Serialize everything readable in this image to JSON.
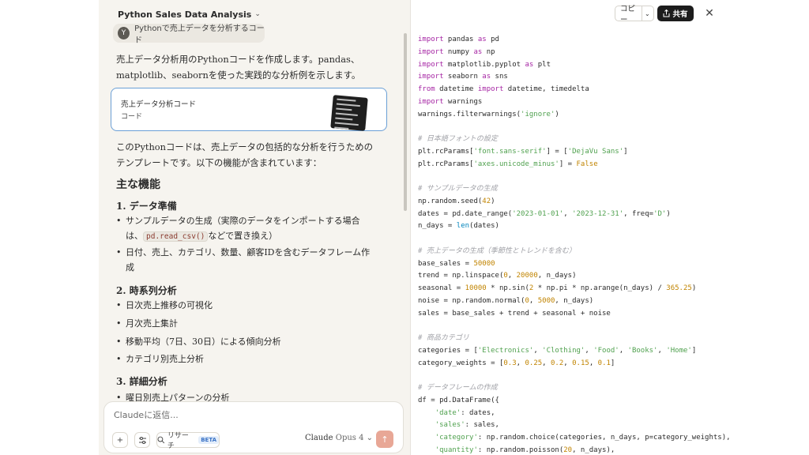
{
  "chat": {
    "title": "Python Sales Data Analysis",
    "caret": "⌄",
    "user_avatar": "Y",
    "user_message": "Pythonで売上データを分析するコード",
    "intro": "売上データ分析用のPythonコードを作成します。pandas、matplotlib、seabornを使った実践的な分析例を示します。",
    "artifact": {
      "title": "売上データ分析コード",
      "subtitle": "コード"
    },
    "summary": "このPythonコードは、売上データの包括的な分析を行うためのテンプレートです。以下の機能が含まれています：",
    "main_heading": "主な機能",
    "sections": [
      {
        "heading": "1. データ準備",
        "items": [
          {
            "pre": "サンプルデータの生成（実際のデータをインポートする場合は、",
            "code": "pd.read_csv()",
            "post": "などで置き換え）"
          },
          {
            "pre": "日付、売上、カテゴリ、数量、顧客IDを含むデータフレーム作成"
          }
        ]
      },
      {
        "heading": "2. 時系列分析",
        "items": [
          {
            "pre": "日次売上推移の可視化"
          },
          {
            "pre": "月次売上集計"
          },
          {
            "pre": "移動平均（7日、30日）による傾向分析"
          },
          {
            "pre": "カテゴリ別売上分析"
          }
        ]
      },
      {
        "heading": "3. 詳細分析",
        "items": [
          {
            "pre": "曜日別売上パターンの分析"
          }
        ]
      }
    ],
    "composer": {
      "placeholder": "Claudeに返信...",
      "research_label": "リサーチ",
      "beta_label": "BETA",
      "model_name": "Claude",
      "model_version": "Opus 4"
    }
  },
  "artifact_panel": {
    "copy_label": "コピー",
    "share_label": "共有",
    "code_lines": [
      [
        {
          "t": "import",
          "c": "kw"
        },
        {
          "t": " pandas "
        },
        {
          "t": "as",
          "c": "kw"
        },
        {
          "t": " pd"
        }
      ],
      [
        {
          "t": "import",
          "c": "kw"
        },
        {
          "t": " numpy "
        },
        {
          "t": "as",
          "c": "kw"
        },
        {
          "t": " np"
        }
      ],
      [
        {
          "t": "import",
          "c": "kw"
        },
        {
          "t": " matplotlib.pyplot "
        },
        {
          "t": "as",
          "c": "kw"
        },
        {
          "t": " plt"
        }
      ],
      [
        {
          "t": "import",
          "c": "kw"
        },
        {
          "t": " seaborn "
        },
        {
          "t": "as",
          "c": "kw"
        },
        {
          "t": " sns"
        }
      ],
      [
        {
          "t": "from",
          "c": "kw"
        },
        {
          "t": " datetime "
        },
        {
          "t": "import",
          "c": "kw"
        },
        {
          "t": " datetime, timedelta"
        }
      ],
      [
        {
          "t": "import",
          "c": "kw"
        },
        {
          "t": " warnings"
        }
      ],
      [
        {
          "t": "warnings.filterwarnings("
        },
        {
          "t": "'ignore'",
          "c": "st"
        },
        {
          "t": ")"
        }
      ],
      [],
      [
        {
          "t": "# 日本語フォントの設定",
          "c": "cm"
        }
      ],
      [
        {
          "t": "plt.rcParams["
        },
        {
          "t": "'font.sans-serif'",
          "c": "st"
        },
        {
          "t": "] = ["
        },
        {
          "t": "'DejaVu Sans'",
          "c": "st"
        },
        {
          "t": "]"
        }
      ],
      [
        {
          "t": "plt.rcParams["
        },
        {
          "t": "'axes.unicode_minus'",
          "c": "st"
        },
        {
          "t": "] = "
        },
        {
          "t": "False",
          "c": "nm"
        }
      ],
      [],
      [
        {
          "t": "# サンプルデータの生成",
          "c": "cm"
        }
      ],
      [
        {
          "t": "np.random.seed("
        },
        {
          "t": "42",
          "c": "nm"
        },
        {
          "t": ")"
        }
      ],
      [
        {
          "t": "dates = pd.date_range("
        },
        {
          "t": "'2023-01-01'",
          "c": "st"
        },
        {
          "t": ", "
        },
        {
          "t": "'2023-12-31'",
          "c": "st"
        },
        {
          "t": ", freq="
        },
        {
          "t": "'D'",
          "c": "st"
        },
        {
          "t": ")"
        }
      ],
      [
        {
          "t": "n_days = "
        },
        {
          "t": "len",
          "c": "bl"
        },
        {
          "t": "(dates)"
        }
      ],
      [],
      [
        {
          "t": "# 売上データの生成（季節性とトレンドを含む）",
          "c": "cm"
        }
      ],
      [
        {
          "t": "base_sales = "
        },
        {
          "t": "50000",
          "c": "nm"
        }
      ],
      [
        {
          "t": "trend = np.linspace("
        },
        {
          "t": "0",
          "c": "nm"
        },
        {
          "t": ", "
        },
        {
          "t": "20000",
          "c": "nm"
        },
        {
          "t": ", n_days)"
        }
      ],
      [
        {
          "t": "seasonal = "
        },
        {
          "t": "10000",
          "c": "nm"
        },
        {
          "t": " * np.sin("
        },
        {
          "t": "2",
          "c": "nm"
        },
        {
          "t": " * np.pi * np.arange(n_days) / "
        },
        {
          "t": "365.25",
          "c": "nm"
        },
        {
          "t": ")"
        }
      ],
      [
        {
          "t": "noise = np.random.normal("
        },
        {
          "t": "0",
          "c": "nm"
        },
        {
          "t": ", "
        },
        {
          "t": "5000",
          "c": "nm"
        },
        {
          "t": ", n_days)"
        }
      ],
      [
        {
          "t": "sales = base_sales + trend + seasonal + noise"
        }
      ],
      [],
      [
        {
          "t": "# 商品カテゴリ",
          "c": "cm"
        }
      ],
      [
        {
          "t": "categories = ["
        },
        {
          "t": "'Electronics'",
          "c": "st"
        },
        {
          "t": ", "
        },
        {
          "t": "'Clothing'",
          "c": "st"
        },
        {
          "t": ", "
        },
        {
          "t": "'Food'",
          "c": "st"
        },
        {
          "t": ", "
        },
        {
          "t": "'Books'",
          "c": "st"
        },
        {
          "t": ", "
        },
        {
          "t": "'Home'",
          "c": "st"
        },
        {
          "t": "]"
        }
      ],
      [
        {
          "t": "category_weights = ["
        },
        {
          "t": "0.3",
          "c": "nm"
        },
        {
          "t": ", "
        },
        {
          "t": "0.25",
          "c": "nm"
        },
        {
          "t": ", "
        },
        {
          "t": "0.2",
          "c": "nm"
        },
        {
          "t": ", "
        },
        {
          "t": "0.15",
          "c": "nm"
        },
        {
          "t": ", "
        },
        {
          "t": "0.1",
          "c": "nm"
        },
        {
          "t": "]"
        }
      ],
      [],
      [
        {
          "t": "# データフレームの作成",
          "c": "cm"
        }
      ],
      [
        {
          "t": "df = pd.DataFrame({"
        }
      ],
      [
        {
          "t": "    "
        },
        {
          "t": "'date'",
          "c": "st"
        },
        {
          "t": ": dates,"
        }
      ],
      [
        {
          "t": "    "
        },
        {
          "t": "'sales'",
          "c": "st"
        },
        {
          "t": ": sales,"
        }
      ],
      [
        {
          "t": "    "
        },
        {
          "t": "'category'",
          "c": "st"
        },
        {
          "t": ": np.random.choice(categories, n_days, p=category_weights),"
        }
      ],
      [
        {
          "t": "    "
        },
        {
          "t": "'quantity'",
          "c": "st"
        },
        {
          "t": ": np.random.poisson("
        },
        {
          "t": "20",
          "c": "nm"
        },
        {
          "t": ", n_days),"
        }
      ]
    ]
  }
}
